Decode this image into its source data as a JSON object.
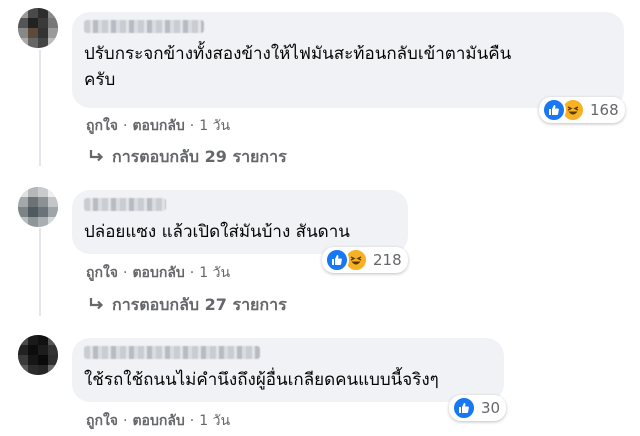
{
  "comments": [
    {
      "text_line1": "ปรับกระจกข้างทั้งสองข้างให้ไฟมันสะท้อนกลับเข้าตามันคืน",
      "text_line2": "ครับ",
      "reaction_count": "168",
      "reactions": [
        "like-icon",
        "haha-icon"
      ],
      "like": "ถูกใจ",
      "reply": "ตอบกลับ",
      "time": "1 วัน",
      "replies_label": "การตอบกลับ 29 รายการ"
    },
    {
      "text_line1": "ปล่อยแซง แล้วเปิดใส่มันบ้าง สันดาน",
      "reaction_count": "218",
      "reactions": [
        "like-icon",
        "haha-icon"
      ],
      "like": "ถูกใจ",
      "reply": "ตอบกลับ",
      "time": "1 วัน",
      "replies_label": "การตอบกลับ 27 รายการ"
    },
    {
      "text_line1": "ใช้รถใช้ถนนไม่คำนึงถึงผู้อื่นเกลียดคนแบบนี้จริงๆ",
      "reaction_count": "30",
      "reactions": [
        "like-icon"
      ],
      "like": "ถูกใจ",
      "reply": "ตอบกลับ",
      "time": "1 วัน"
    }
  ],
  "separator": "·",
  "colors": {
    "bubble": "#f0f2f5",
    "meta_text": "#65676b",
    "like_blue": "#1877f2",
    "haha_yellow": "#f7b125"
  }
}
